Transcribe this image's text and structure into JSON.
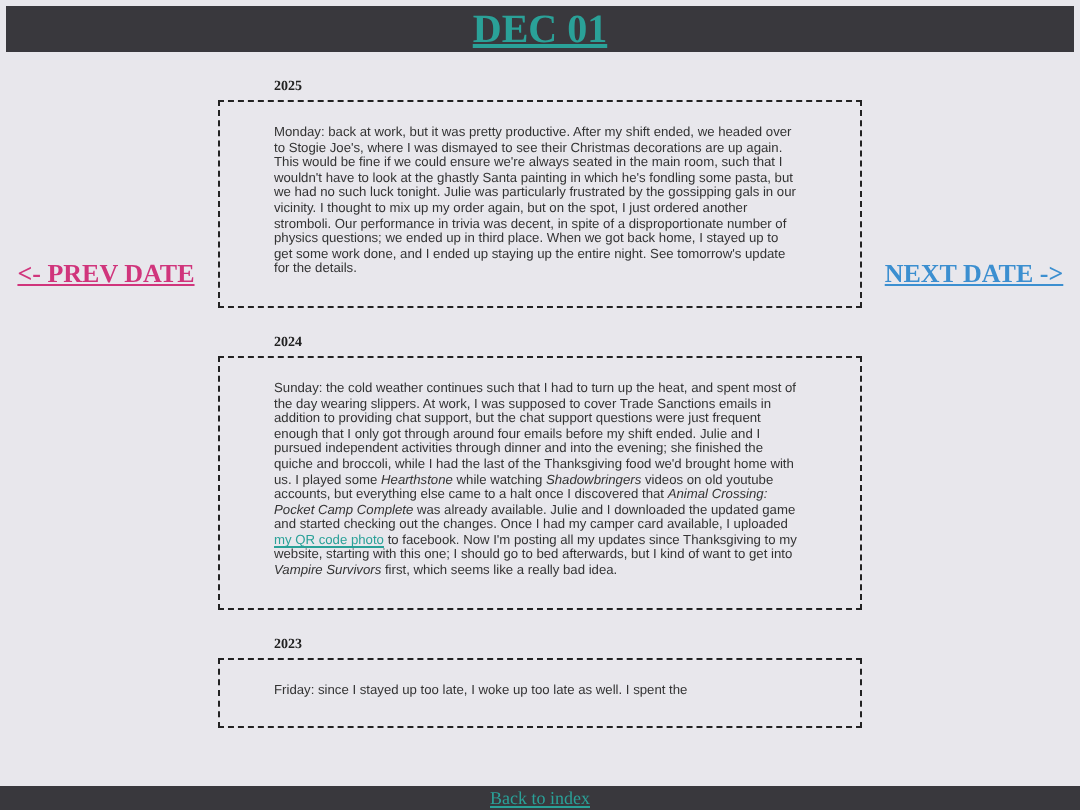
{
  "header": {
    "title": "DEC 01"
  },
  "nav": {
    "prev": "<- PREV DATE",
    "next": "NEXT DATE ->"
  },
  "entries": [
    {
      "year": "2025",
      "body": [
        {
          "kind": "text",
          "text": "Monday: back at work, but it was pretty productive. After my shift ended, we headed over to Stogie Joe's, where I was dismayed to see their Christmas decorations are up again. This would be fine if we could ensure we're always seated in the main room, such that I wouldn't have to look at the ghastly Santa painting in which he's fondling some pasta, but we had no such luck tonight. Julie was particularly frustrated by the gossipping gals in our vicinity. I thought to mix up my order again, but on the spot, I just ordered another stromboli. Our performance in trivia was decent, in spite of a disproportionate number of physics questions; we ended up in third place. When we got back home, I stayed up to get some work done, and I ended up staying up the entire night. See tomorrow's update for the details."
        }
      ]
    },
    {
      "year": "2024",
      "body": [
        {
          "kind": "text",
          "text": "Sunday: the cold weather continues such that I had to turn up the heat, and spent most of the day wearing slippers. At work, I was supposed to cover Trade Sanctions emails in addition to providing chat support, but the chat support questions were just frequent enough that I only got through around four emails before my shift ended. Julie and I pursued independent activities through dinner and into the evening; she finished the quiche and broccoli, while I had the last of the Thanksgiving food we'd brought home with us. I played some *Hearthstone* while watching *Shadowbringers* videos on old youtube accounts, but everything else came to a halt once I discovered that *Animal Crossing: Pocket Camp Complete* was already available. Julie and I downloaded the updated game and started checking out the changes. Once I had my camper card available, I uploaded "
        },
        {
          "kind": "link",
          "text": "my QR code photo"
        },
        {
          "kind": "text",
          "text": " to facebook. Now I'm posting all my updates since Thanksgiving to my website, starting with this one; I should go to bed afterwards, but I kind of want to get into *Vampire Survivors* first, which seems like a really bad idea."
        }
      ]
    },
    {
      "year": "2023",
      "body": [
        {
          "kind": "text",
          "text": "Friday: since I stayed up too late, I woke up too late as well. I spent the"
        }
      ]
    }
  ],
  "footer": {
    "link": "Back to index"
  }
}
